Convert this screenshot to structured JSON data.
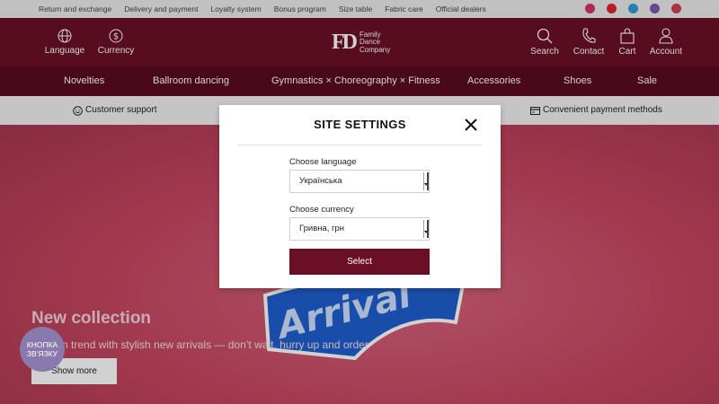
{
  "topbar": {
    "links": [
      "Return and exchange",
      "Delivery and payment",
      "Loyalty system",
      "Bonus program",
      "Size table",
      "Fabric care",
      "Official dealers"
    ],
    "social": [
      {
        "icon": "instagram-icon",
        "color": "#d6336c"
      },
      {
        "icon": "youtube-icon",
        "color": "#e0242b"
      },
      {
        "icon": "telegram-icon",
        "color": "#2a9fd8"
      },
      {
        "icon": "viber-icon",
        "color": "#7d58b3"
      },
      {
        "icon": "pinterest-icon",
        "color": "#d63a52"
      }
    ]
  },
  "header": {
    "language_label": "Language",
    "currency_label": "Currency",
    "logo_mark": "FD",
    "logo_line1": "Family",
    "logo_line2": "Dance",
    "logo_line3": "Company",
    "search_label": "Search",
    "contact_label": "Contact",
    "cart_label": "Cart",
    "account_label": "Account"
  },
  "nav": {
    "items": [
      "Novelties",
      "Ballroom dancing",
      "Gymnastics × Choreography × Fitness",
      "Accessories",
      "Shoes",
      "Sale"
    ]
  },
  "strip": {
    "support": "Customer support",
    "payment": "Convenient payment methods"
  },
  "hero": {
    "title": "New collection",
    "subtitle": "Stay on trend with stylish new arrivals — don’t wait, hurry up and order",
    "button": "Show more",
    "art_text": "Arrival"
  },
  "contact_button": {
    "line1": "КНОПКА",
    "line2": "ЗВ'ЯЗКУ"
  },
  "modal": {
    "title": "SITE SETTINGS",
    "language_label": "Choose language",
    "language_value": "Українська",
    "currency_label": "Choose currency",
    "currency_value": "Гривна, грн",
    "submit": "Select"
  },
  "colors": {
    "brand": "#6b0f27",
    "nav": "#5a0c20",
    "hero": "#c4455f"
  }
}
